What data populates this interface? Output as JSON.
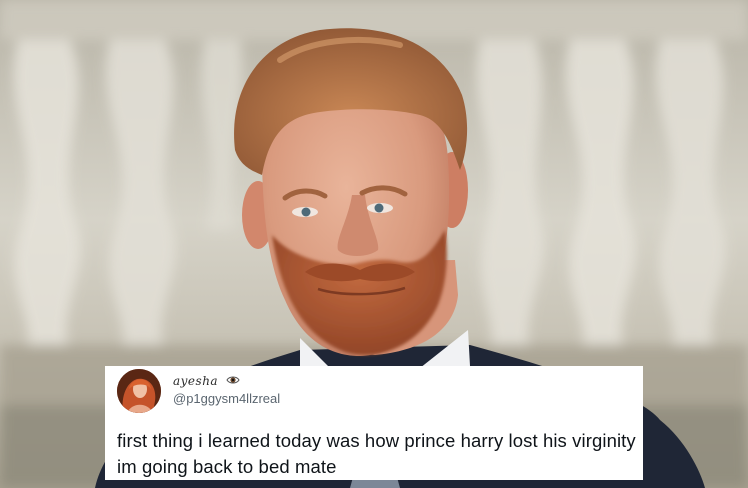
{
  "tweet": {
    "display_name": "ayesha",
    "name_emoji": "eye-emoji",
    "handle": "@p1ggysm4llzreal",
    "text": "first thing i learned today was how prince harry lost his virginity im going back to bed mate",
    "avatar": "profile-photo-avatar"
  },
  "photo": {
    "subject": "man-with-red-beard-in-suit",
    "background": "blurred-stone-balustrade"
  },
  "colors": {
    "card_bg": "#ffffff",
    "text": "#0f1419",
    "handle": "#5b6670"
  }
}
